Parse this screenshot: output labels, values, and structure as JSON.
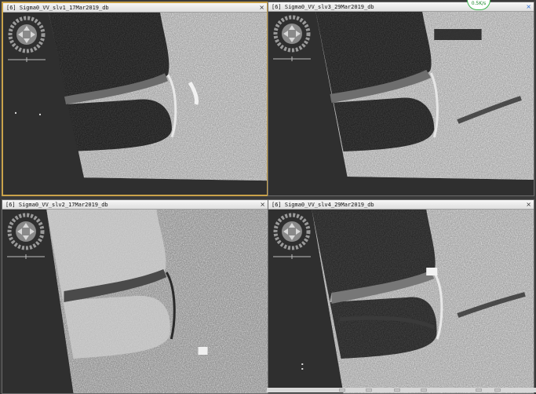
{
  "panes": [
    {
      "title": "[6] Sigma0_VV_slv1_17Mar2019_db",
      "close_glyph": "×",
      "active": true
    },
    {
      "title": "[6] Sigma0_VV_slv3_29Mar2019_db",
      "close_glyph": "×",
      "active": false
    },
    {
      "title": "[6] Sigma0_VV_slv2_17Mar2019_db",
      "close_glyph": "×",
      "active": false
    },
    {
      "title": "[6] Sigma0_VV_slv4_29Mar2019_db",
      "close_glyph": "×",
      "active": false
    }
  ],
  "network_badge": {
    "label": "0.5K/s"
  },
  "icons": {
    "navigation": "pan-compass-icon",
    "scale": "scale-bar-icon",
    "close": "close-icon"
  },
  "colors": {
    "active_border": "#c9a24a",
    "water": "#1c1c1c",
    "land": "#b8b8b8",
    "background": "#2f2f2f"
  }
}
